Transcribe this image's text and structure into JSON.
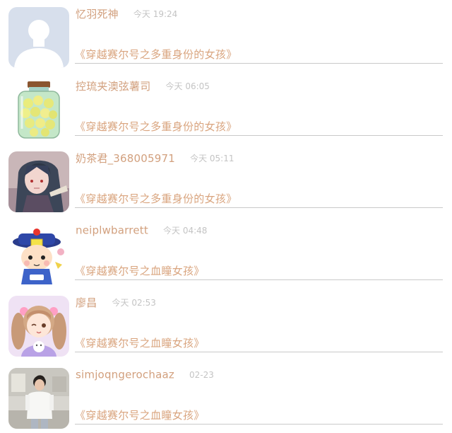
{
  "list": {
    "items": [
      {
        "name": "忆羽死神",
        "time": "今天 19:24",
        "book": "《穿越赛尔号之多重身份的女孩》",
        "avatar_icon": "default-user-silhouette"
      },
      {
        "name": "控琉夹澳弦薯司",
        "time": "今天 06:05",
        "book": "《穿越赛尔号之多重身份的女孩》",
        "avatar_icon": "jar-of-yellow-chicks"
      },
      {
        "name": "奶茶君_368005971",
        "time": "今天 05:11",
        "book": "《穿越赛尔号之多重身份的女孩》",
        "avatar_icon": "anime-girl-dark-hair"
      },
      {
        "name": "neiplwbarrett",
        "time": "今天 04:48",
        "book": "《穿越赛尔号之血瞳女孩》",
        "avatar_icon": "cartoon-qing-official-hat"
      },
      {
        "name": "廖昌",
        "time": "今天 02:53",
        "book": "《穿越赛尔号之血瞳女孩》",
        "avatar_icon": "anime-girl-pigtails-purple"
      },
      {
        "name": "simjoqngerochaaz",
        "time": "02-23",
        "book": "《穿越赛尔号之血瞳女孩》",
        "avatar_icon": "photo-person-white-shirt"
      }
    ]
  },
  "colors": {
    "name": "#d2a07e",
    "book_title": "#d9a47e",
    "time": "#c4c4c4",
    "divider": "#c9c9c9"
  }
}
